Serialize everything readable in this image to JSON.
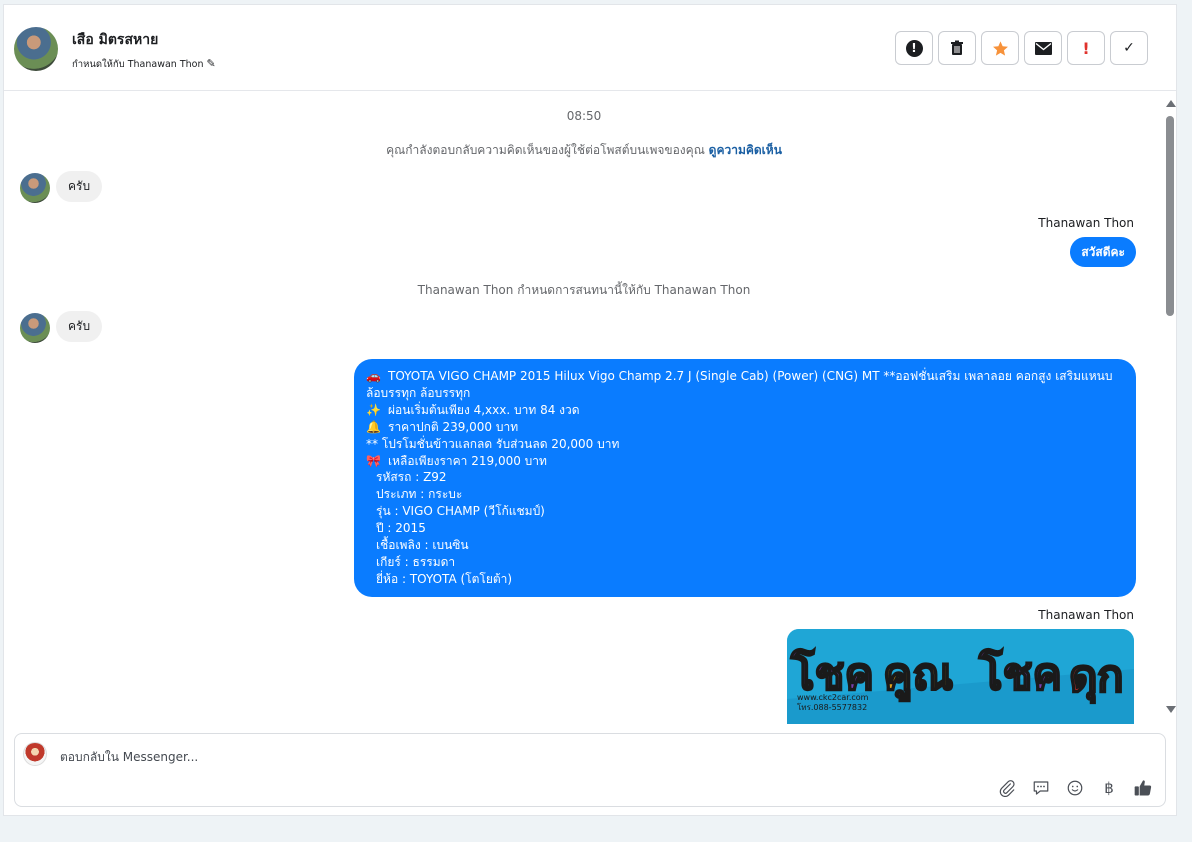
{
  "header": {
    "contact_name": "เสือ มิตรสหาย",
    "assigned_text": "กำหนดให้กับ Thanawan Thon",
    "action_icons": [
      "alert-circle-icon",
      "trash-icon",
      "star-icon",
      "mail-icon",
      "exclamation-icon",
      "check-icon"
    ],
    "colors": {
      "star": "#f7923a",
      "exclamation": "#e0322c"
    }
  },
  "conversation": {
    "timestamp": "08:50",
    "system_reply_notice": "คุณกำลังตอบกลับความคิดเห็นของผู้ใช้ต่อโพสต์บนเพจของคุณ",
    "view_comment_link": "ดูความคิดเห็น",
    "incoming_1": "ครับ",
    "sender_1": "Thanawan Thon",
    "outgoing_1": "สวัสดีคะ",
    "system_assignment": "Thanawan Thon กำหนดการสนทนานี้ให้กับ Thanawan Thon",
    "incoming_2": "ครับ",
    "listing": {
      "line1": "TOYOTA VIGO CHAMP 2015 Hilux Vigo Champ 2.7 J (Single Cab) (Power) (CNG) MT **ออฟชั่นเสริม เพลาลอย คอกสูง เสริมแหนบ ล้อบรรทุก ล้อบรรทุก",
      "line2": "ผ่อนเริ่มต้นเพียง 4,xxx. บาท 84 งวด",
      "line3": "ราคาปกติ 239,000 บาท",
      "line4": "** โปรโมชั่นข้าวแลกลด รับส่วนลด 20,000 บาท",
      "line5": "เหลือเพียงราคา 219,000 บาท",
      "line6": "รหัสรถ : Z92",
      "line7": "ประเภท : กระบะ",
      "line8": "รุ่น : VIGO CHAMP (วีโก้แชมป์)",
      "line9": "ปี : 2015",
      "line10": "เชื้อเพลิง : เบนซิน",
      "line11": "เกียร์ : ธรรมดา",
      "line12": "ยี่ห้อ : TOYOTA (โตโยต้า)"
    },
    "sender_2": "Thanawan Thon",
    "image_text": {
      "website": "www.ckc2car.com",
      "phone": "โทร.088-5577832"
    },
    "bubble_color": "#0a7cff"
  },
  "composer": {
    "placeholder": "ตอบกลับใน Messenger...",
    "tool_icons": [
      "paperclip-icon",
      "saved-reply-icon",
      "emoji-icon",
      "baht-icon",
      "like-icon"
    ]
  }
}
